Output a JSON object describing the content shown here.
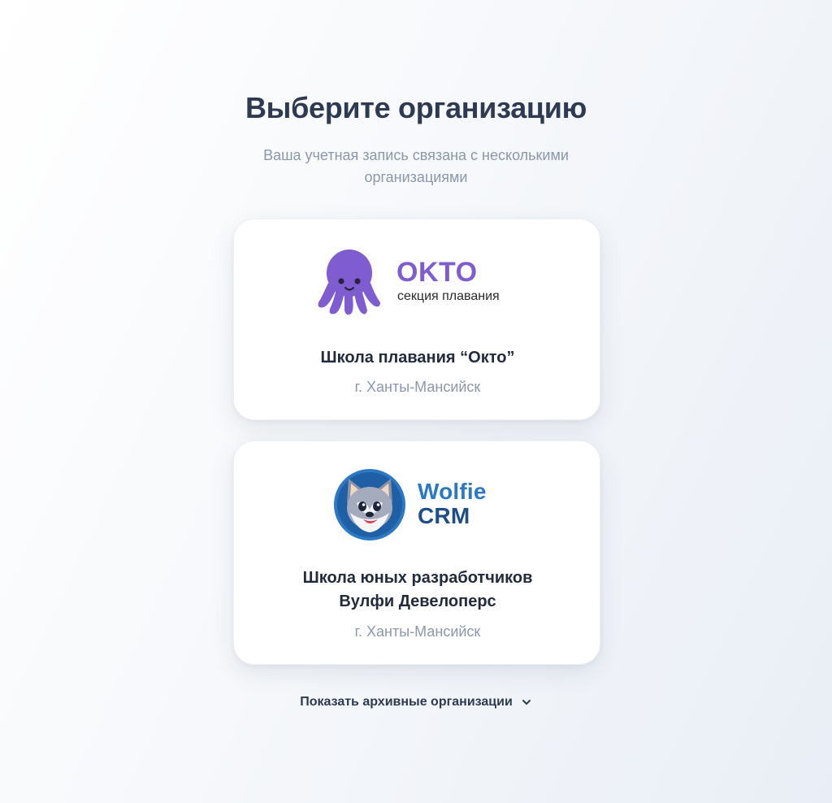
{
  "header": {
    "title": "Выберите организацию",
    "subtitle": "Ваша учетная запись связана с несколькими организациями"
  },
  "organizations": [
    {
      "logo_brand": "OKTO",
      "logo_tagline": "секция плавания",
      "name": "Школа плавания “Окто”",
      "city": "г. Ханты-Мансийск",
      "brand_color": "#7f5ccf",
      "icon": "octopus-icon"
    },
    {
      "logo_brand_line1": "Wolfie",
      "logo_brand_line2": "CRM",
      "name_line1": "Школа юных разработчиков",
      "name_line2": "Вулфи Девелоперс",
      "city": "г. Ханты-Мансийск",
      "brand_color": "#2c78c2",
      "icon": "wolf-icon"
    }
  ],
  "footer": {
    "archive_label": "Показать архивные организации",
    "archive_icon": "chevron-down-icon"
  }
}
